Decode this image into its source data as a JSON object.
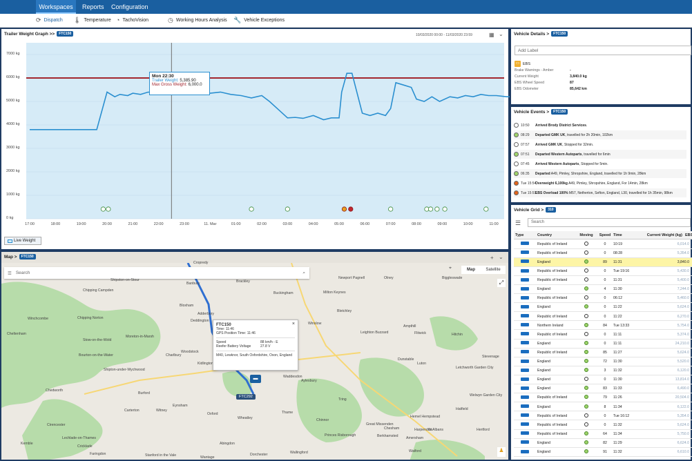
{
  "topnav": {
    "workspaces": "Workspaces",
    "reports": "Reports",
    "configuration": "Configuration"
  },
  "subnav": {
    "dispatch": "Dispatch",
    "temperature": "Temperature",
    "tachovision": "TachoVision",
    "working_hours": "Working Hours Analysis",
    "vehicle_exceptions": "Vehicle Exceptions"
  },
  "graph": {
    "title": "Trailer Weight Graph >>",
    "badge": "FTC150",
    "range": "10/03/2020 00:00 - 11/03/2020 23:59",
    "live_weight_button": "Live Weight",
    "tooltip": {
      "time": "Mon 22:30",
      "trailer_label": "Trailer Weight:",
      "trailer_value": "5,385.90",
      "max_label": "Max Gross Weight:",
      "max_value": "6,000.0"
    }
  },
  "chart_data": {
    "type": "line",
    "yticks": [
      "7000 kg",
      "6000 kg",
      "5000 kg",
      "4000 kg",
      "3000 kg",
      "2000 kg",
      "1000 kg",
      "0 kg"
    ],
    "xticks": [
      "17:00",
      "18:00",
      "19:00",
      "20:00",
      "21:00",
      "22:00",
      "23:00",
      "11. Mar",
      "01:00",
      "02:00",
      "03:00",
      "04:00",
      "05:00",
      "06:00",
      "07:00",
      "08:00",
      "09:00",
      "10:00",
      "11:00"
    ],
    "ylim": [
      0,
      7500
    ],
    "max_gross_weight": 6000,
    "cursor_x": 5.5,
    "series": [
      {
        "x": [
          0,
          2.6,
          3.0,
          3.3,
          3.5,
          3.8,
          4.0,
          4.3,
          4.6,
          5.0,
          5.3,
          5.6,
          6.0,
          6.5,
          7.0,
          7.4,
          7.8,
          8.2,
          8.6,
          9.0,
          9.3,
          9.6,
          10.0,
          10.3,
          10.6,
          11.0,
          11.4,
          11.7,
          12.0,
          12.1,
          12.3,
          12.5,
          12.9,
          13.2,
          13.5,
          13.8,
          14.0,
          14.2,
          14.5,
          14.8,
          15.0,
          15.3,
          15.6,
          15.9,
          16.3,
          16.6,
          16.9,
          17.2,
          17.5,
          17.8,
          18.1,
          18.5,
          18.8,
          19.2,
          19.6,
          19.9
        ],
        "y": [
          3800,
          3800,
          5400,
          5200,
          5300,
          5250,
          5350,
          5300,
          5400,
          5300,
          5385,
          5350,
          5300,
          5400,
          5350,
          5400,
          5300,
          5250,
          5150,
          5250,
          5000,
          4700,
          4300,
          4320,
          4280,
          4400,
          4220,
          4300,
          4300,
          5400,
          6200,
          6200,
          4500,
          4400,
          4500,
          4400,
          4700,
          5800,
          5700,
          5600,
          5100,
          5000,
          5200,
          5000,
          5200,
          5150,
          5250,
          5200,
          5300,
          5250,
          5250,
          5200,
          5200,
          4500,
          3800,
          3800
        ]
      }
    ],
    "markers_x": [
      2.85,
      3.05,
      8.6,
      10.0,
      12.2,
      12.45,
      14.0,
      15.4,
      15.55,
      15.8,
      16.1,
      17.7
    ]
  },
  "details": {
    "title": "Vehicle Details >",
    "badge": "FTC150",
    "add_label": "Add Label",
    "ebs": "EBS",
    "rows": [
      {
        "label": "Brake Warnings - Amber",
        "value": "-"
      },
      {
        "label": "Current Weight",
        "value": "3,840.0 kg"
      },
      {
        "label": "EBS Wheel Speed",
        "value": "87"
      },
      {
        "label": "EBS Odometer",
        "value": "85,642 km"
      }
    ]
  },
  "events": {
    "title": "Vehicle Events >",
    "badge": "FTC150",
    "rows": [
      {
        "time": "10:50",
        "bold": "Arrived Brody District Services",
        "text": ".",
        "color": "#ffffff"
      },
      {
        "time": "08:29",
        "bold": "Departed GMK UK",
        "text": ", travelled for 2h 20min, 102km",
        "color": "#9fd36a"
      },
      {
        "time": "07:57",
        "bold": "Arrived GMK UK",
        "text": ", Stopped for 32min.",
        "color": "#ffffff"
      },
      {
        "time": "07:51",
        "bold": "Departed Western Autoparts",
        "text": ", travelled for 6min",
        "color": "#9fd36a"
      },
      {
        "time": "07:45",
        "bold": "Arrived Western Autoparts",
        "text": ", Stopped for 5min.",
        "color": "#ffffff"
      },
      {
        "time": "06:35",
        "bold": "Departed",
        "text": " A49, Pimley, Shropshire, England, travelled for 1h 9min, 28km",
        "color": "#9fd36a"
      },
      {
        "time": "Tue 15:54",
        "bold": "Overweight 6,100kg",
        "text": " A49, Pimley, Shropshire, England, For 14min, 28km",
        "color": "#e2631c"
      },
      {
        "time": "Tue 15:51",
        "bold": "EBS Overload 100%",
        "text": " M57, Netherton, Sefton, England, L30, travelled for 1h 35min, 98km",
        "color": "#e2631c"
      }
    ]
  },
  "grid": {
    "title": "Vehicle Grid >",
    "badge": "310",
    "search_placeholder": "Search",
    "columns": [
      "Type",
      "Country",
      "Moving",
      "Speed",
      "Time",
      "Current Weight (kg)",
      "EBS"
    ],
    "rows": [
      {
        "country": "Republic of Ireland",
        "moving": "stop",
        "speed": "0",
        "time": "10:19",
        "weight": "6,014.0"
      },
      {
        "country": "Republic of Ireland",
        "moving": "stop",
        "speed": "0",
        "time": "08:28",
        "weight": "5,354.0"
      },
      {
        "country": "England",
        "moving": "move",
        "speed": "89",
        "time": "11:31",
        "weight": "3,840.0"
      },
      {
        "country": "Republic of Ireland",
        "moving": "stop",
        "speed": "0",
        "time": "Tue 19:16",
        "weight": "5,430.0"
      },
      {
        "country": "Republic of Ireland",
        "moving": "stop",
        "speed": "0",
        "time": "11:31",
        "weight": "5,400.0"
      },
      {
        "country": "England",
        "moving": "move",
        "speed": "4",
        "time": "11:30",
        "weight": "7,244.0"
      },
      {
        "country": "Republic of Ireland",
        "moving": "stop",
        "speed": "0",
        "time": "06:12",
        "weight": "5,460.0"
      },
      {
        "country": "England",
        "moving": "move",
        "speed": "0",
        "time": "11:22",
        "weight": "5,624.0"
      },
      {
        "country": "Republic of Ireland",
        "moving": "stop",
        "speed": "0",
        "time": "11:22",
        "weight": "6,270.0"
      },
      {
        "country": "Northern Ireland",
        "moving": "move",
        "speed": "84",
        "time": "Tue 13:33",
        "weight": "5,754.0"
      },
      {
        "country": "Republic of Ireland",
        "moving": "stop",
        "speed": "0",
        "time": "11:11",
        "weight": "5,374.0"
      },
      {
        "country": "England",
        "moving": "move",
        "speed": "0",
        "time": "11:11",
        "weight": "24,210.0"
      },
      {
        "country": "Republic of Ireland",
        "moving": "move",
        "speed": "85",
        "time": "11:27",
        "weight": "5,624.0"
      },
      {
        "country": "England",
        "moving": "move",
        "speed": "72",
        "time": "11:30",
        "weight": "5,520.0"
      },
      {
        "country": "England",
        "moving": "move",
        "speed": "3",
        "time": "11:32",
        "weight": "6,120.0"
      },
      {
        "country": "England",
        "moving": "stop",
        "speed": "0",
        "time": "11:30",
        "weight": "13,814.0"
      },
      {
        "country": "England",
        "moving": "move",
        "speed": "83",
        "time": "11:33",
        "weight": "6,490.0"
      },
      {
        "country": "Republic of Ireland",
        "moving": "move",
        "speed": "79",
        "time": "11:26",
        "weight": "20,504.0"
      },
      {
        "country": "England",
        "moving": "move",
        "speed": "8",
        "time": "11:34",
        "weight": "6,122.0"
      },
      {
        "country": "Republic of Ireland",
        "moving": "stop",
        "speed": "0",
        "time": "Tue 16:12",
        "weight": "5,354.0"
      },
      {
        "country": "Republic of Ireland",
        "moving": "stop",
        "speed": "0",
        "time": "11:32",
        "weight": "5,624.0"
      },
      {
        "country": "Republic of Ireland",
        "moving": "move",
        "speed": "64",
        "time": "11:34",
        "weight": "5,750.0"
      },
      {
        "country": "England",
        "moving": "move",
        "speed": "82",
        "time": "11:29",
        "weight": "6,624.0"
      },
      {
        "country": "England",
        "moving": "move",
        "speed": "91",
        "time": "11:32",
        "weight": "6,610.0"
      }
    ]
  },
  "map": {
    "title": "Map >",
    "badge": "FTC150",
    "search_placeholder": "Search",
    "map_button": "Map",
    "satellite_button": "Satellite",
    "vehicle_label": "FTC292",
    "popup": {
      "title": "FTC150",
      "time": "Time: 11:46",
      "gps_time": "GPS Position Time: 11:46",
      "speed_label": "Speed",
      "speed_value": "88 km/h - E",
      "reefer_label": "Reefer Battery Voltage",
      "reefer_value": "27.8 V",
      "location": "M40, Lewknor, South Oxfordshire, Oxon, England"
    },
    "places": [
      "Cropredy",
      "Banbury",
      "Brackley",
      "Buckingham",
      "Milton Keynes",
      "Bletchley",
      "Newport Pagnell",
      "Olney",
      "Biggleswade",
      "Shipston-on-Stour",
      "Chipping Campden",
      "Chipping Norton",
      "Bloxham",
      "Adderbury",
      "Deddington",
      "Woodstock",
      "Kidlington",
      "Bicester",
      "Oxford",
      "Wheatley",
      "Thame",
      "Aylesbury",
      "Tring",
      "Hemel Hempstead",
      "St Albans",
      "Luton",
      "Dunstable",
      "Hitchin",
      "Stevenage",
      "Letchworth Garden City",
      "Welwyn Garden City",
      "Hatfield",
      "Watford",
      "Witney",
      "Carterton",
      "Cirencester",
      "Cheltenham",
      "Chedworth",
      "Bourton-on-the-Water",
      "Stow-on-the-Wold",
      "Moreton-in-Marsh",
      "Winchcombe",
      "Shipton-under-Wychwood",
      "Charlbury",
      "Burford",
      "Cricklade",
      "Abingdon",
      "Dorchester",
      "Waddesdon",
      "Winslow",
      "Leighton Buzzard",
      "Ampthill",
      "Flitwick",
      "Hertford",
      "Harpenden",
      "Kemble",
      "Lechlade-on-Thames",
      "Wallingford",
      "Princes Risborough",
      "Chinnor",
      "Berkhamsted",
      "Chesham",
      "Amersham",
      "Great Missenden",
      "Stanford in the Vale",
      "Wantage",
      "Faringdon",
      "Eynsham"
    ]
  }
}
